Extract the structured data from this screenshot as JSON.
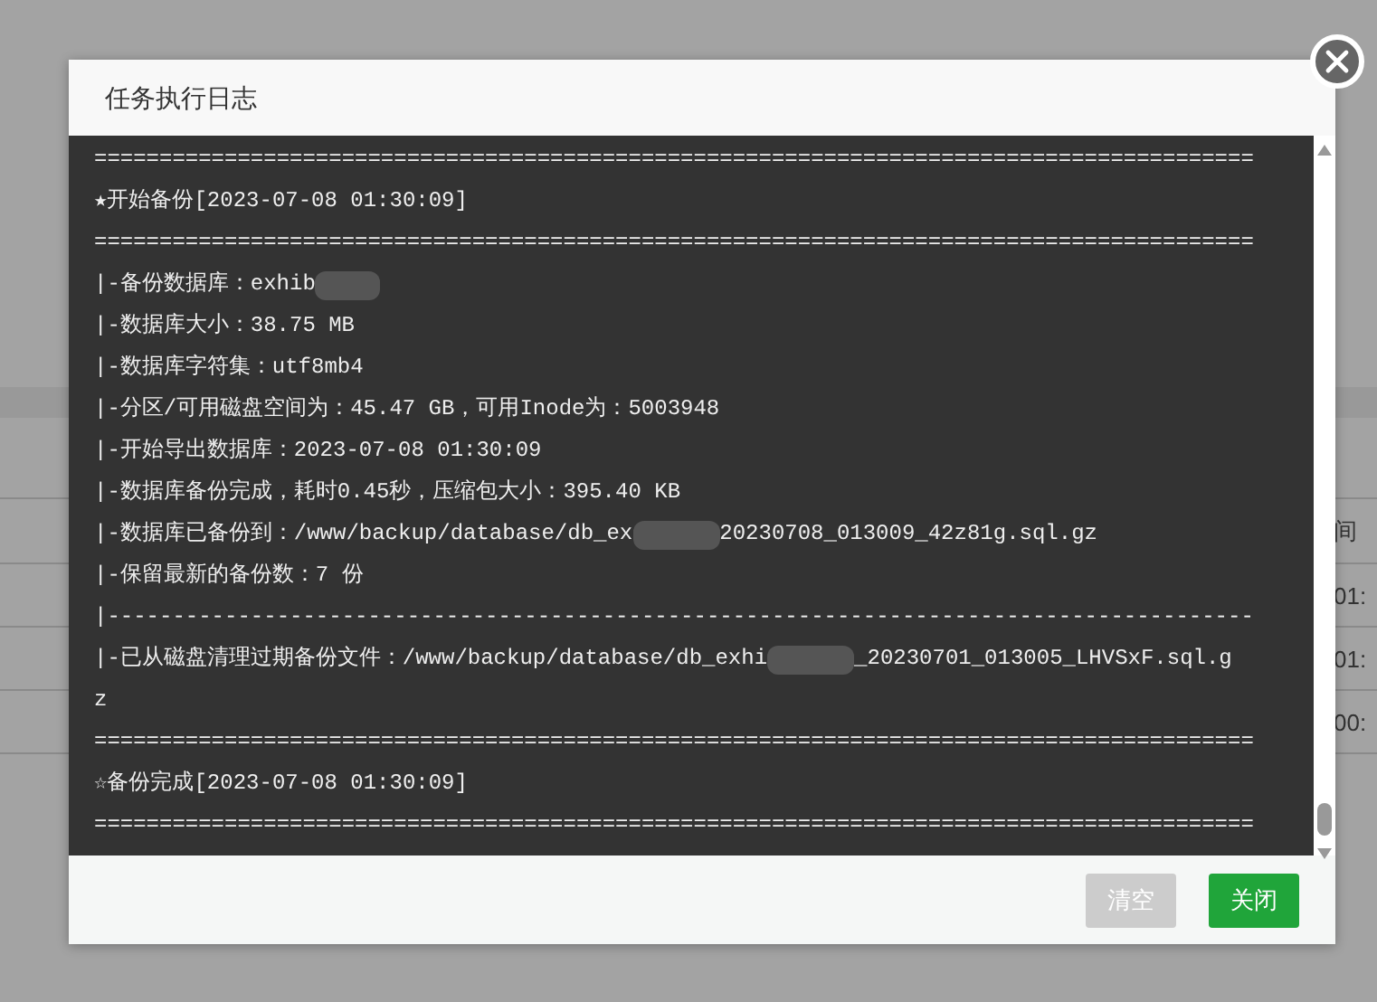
{
  "background_table": {
    "header": "间",
    "cells": [
      "01:",
      "01:",
      "00:"
    ]
  },
  "dialog": {
    "title": "任务执行日志",
    "log": [
      {
        "kind": "rule",
        "parts": [
          "========================================================================================="
        ]
      },
      {
        "kind": "header",
        "parts": [
          "★开始备份",
          "[2023-07-08 01:30:09]"
        ]
      },
      {
        "kind": "rule",
        "parts": [
          "========================================================================================="
        ]
      },
      {
        "kind": "text",
        "parts": [
          "|-备份数据库：exhib"
        ],
        "redacted_end": true
      },
      {
        "kind": "text",
        "parts": [
          "|-数据库大小：38.75 MB"
        ]
      },
      {
        "kind": "text",
        "parts": [
          "|-数据库字符集：utf8mb4"
        ]
      },
      {
        "kind": "text",
        "parts": [
          "|-分区/可用磁盘空间为：45.47 GB，可用Inode为：5003948"
        ]
      },
      {
        "kind": "text",
        "parts": [
          "|-开始导出数据库：2023-07-08 01:30:09"
        ]
      },
      {
        "kind": "text",
        "parts": [
          "|-数据库备份完成，耗时0.45秒，压缩包大小：395.40 KB"
        ]
      },
      {
        "kind": "text",
        "parts": [
          "|-数据库已备份到：/www/backup/database/db_ex",
          "20230708_013009_42z81g.sql.gz"
        ]
      },
      {
        "kind": "text",
        "parts": [
          "|-保留最新的备份数：7 份"
        ]
      },
      {
        "kind": "text",
        "parts": [
          "|----------------------------------------------------------------------------------------"
        ]
      },
      {
        "kind": "text",
        "parts": [
          "|-已从磁盘清理过期备份文件：/www/backup/database/db_exhi",
          "_20230701_013005_LHVSxF.sql.g"
        ]
      },
      {
        "kind": "text",
        "parts": [
          "z"
        ]
      },
      {
        "kind": "rule",
        "parts": [
          "========================================================================================="
        ]
      },
      {
        "kind": "header",
        "parts": [
          "☆备份完成",
          "[2023-07-08 01:30:09]"
        ]
      },
      {
        "kind": "rule",
        "parts": [
          "========================================================================================="
        ]
      }
    ],
    "buttons": [
      {
        "label": "清空",
        "disabled": true
      },
      {
        "label": "关闭",
        "disabled": false
      }
    ]
  }
}
